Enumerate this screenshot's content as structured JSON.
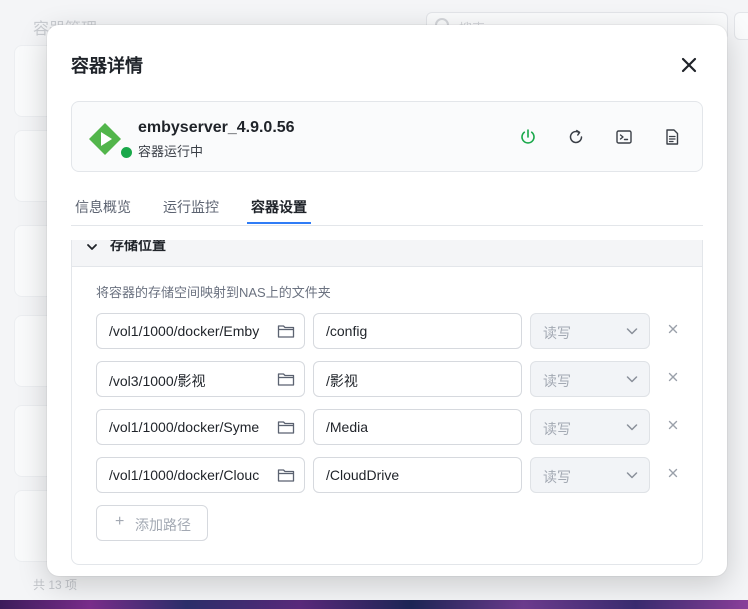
{
  "background": {
    "page_title": "容器管理",
    "search_placeholder": "搜索",
    "footer_count": "共 13 项"
  },
  "modal": {
    "title": "容器详情",
    "close_icon": "close-icon"
  },
  "container": {
    "name": "embyserver_4.9.0.56",
    "status": "容器运行中",
    "status_color": "#19a84a",
    "logo_color": "#52b54b",
    "actions": [
      {
        "name": "power-icon",
        "color": "#19a84a"
      },
      {
        "name": "restart-icon",
        "color": "#3a3f47"
      },
      {
        "name": "terminal-icon",
        "color": "#3a3f47"
      },
      {
        "name": "log-icon",
        "color": "#3a3f47"
      }
    ]
  },
  "tabs": [
    {
      "label": "信息概览",
      "active": false
    },
    {
      "label": "运行监控",
      "active": false
    },
    {
      "label": "容器设置",
      "active": true
    }
  ],
  "accent_color": "#2f7cf6",
  "storage": {
    "title": "存储位置",
    "description": "将容器的存储空间映射到NAS上的文件夹",
    "rows": [
      {
        "host": "/vol1/1000/docker/Emby",
        "container": "/config",
        "permission": "读写"
      },
      {
        "host": "/vol3/1000/影视",
        "container": "/影视",
        "permission": "读写"
      },
      {
        "host": "/vol1/1000/docker/Syme",
        "container": "/Media",
        "permission": "读写"
      },
      {
        "host": "/vol1/1000/docker/Clouc",
        "container": "/CloudDrive",
        "permission": "读写"
      }
    ],
    "add_label": "添加路径"
  }
}
